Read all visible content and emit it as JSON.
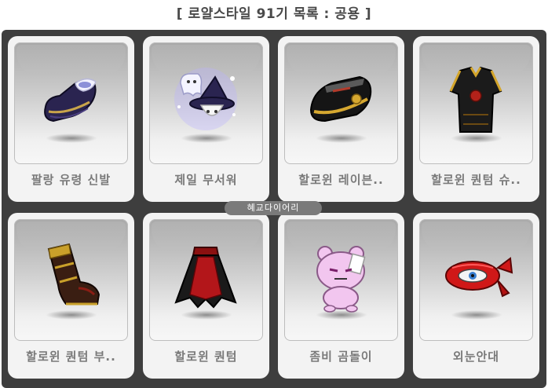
{
  "page": {
    "title": "[ 로얄스타일 91기 목록 : 공용 ]"
  },
  "watermark": "혜교다이어리",
  "items": [
    {
      "name": "팔랑 유령 신발",
      "icon": "ghost-shoe-icon"
    },
    {
      "name": "제일 무서워",
      "icon": "ghost-wizard-hat-icon"
    },
    {
      "name": "할로윈 레이븐..",
      "icon": "halloween-raven-hat-icon"
    },
    {
      "name": "할로윈 퀀텀 슈..",
      "icon": "halloween-quantum-suit-icon"
    },
    {
      "name": "할로윈 퀀텀 부..",
      "icon": "halloween-quantum-boots-icon"
    },
    {
      "name": "할로윈 퀀텀",
      "icon": "halloween-quantum-cape-icon"
    },
    {
      "name": "좀비 곰돌이",
      "icon": "zombie-bear-icon"
    },
    {
      "name": "외눈안대",
      "icon": "eye-patch-icon"
    }
  ],
  "colors": {
    "panel_bg": "#3e3e3e",
    "card_bg": "#f3f3f3",
    "label_text": "#7a7a7a",
    "title_text": "#4a4a4a"
  }
}
